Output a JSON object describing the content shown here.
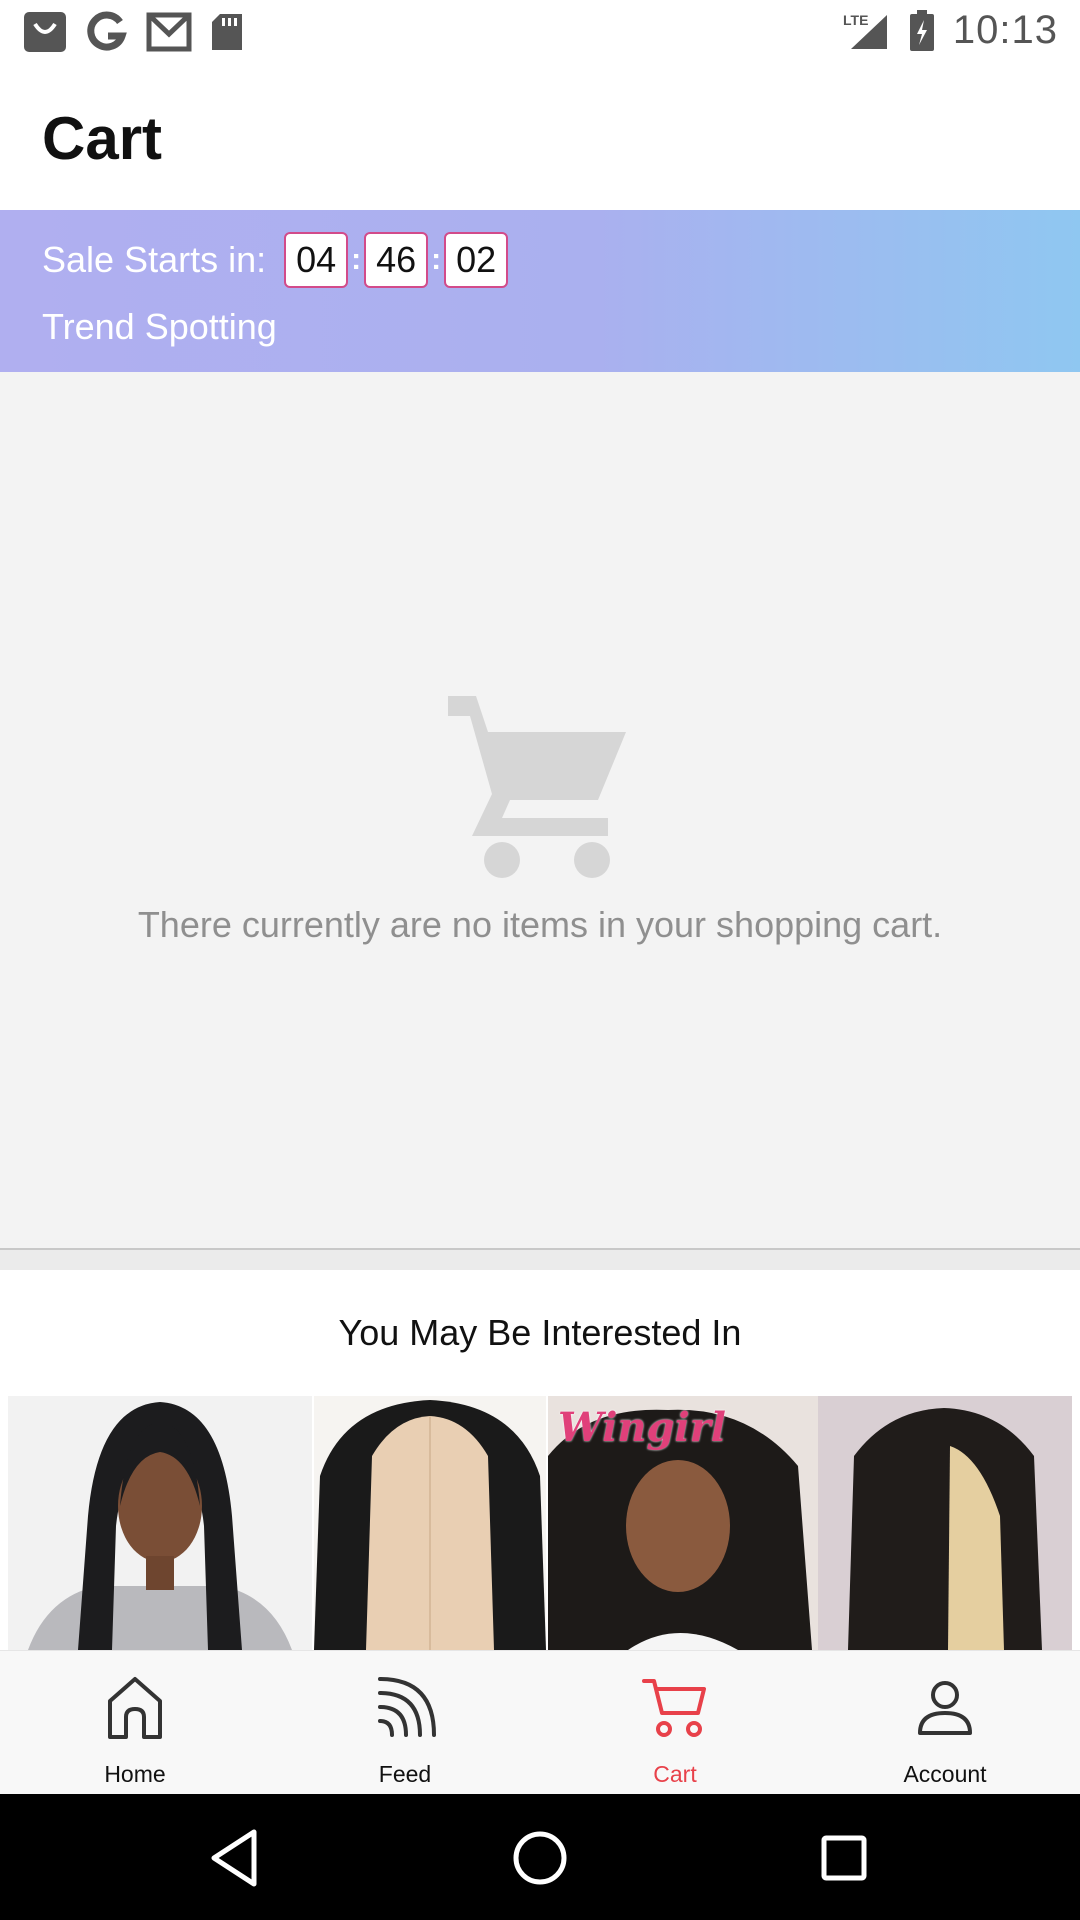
{
  "status_bar": {
    "time": "10:13",
    "network": "LTE",
    "left_icons": [
      "shopping-bag-icon",
      "google-icon",
      "gmail-icon",
      "sd-card-icon"
    ]
  },
  "header": {
    "title": "Cart"
  },
  "banner": {
    "sale_label": "Sale Starts in:",
    "countdown": {
      "hours": "04",
      "minutes": "46",
      "seconds": "02"
    },
    "subtitle": "Trend Spotting",
    "gradient_colors": [
      "#b0aff0",
      "#8fc7f1"
    ]
  },
  "empty_cart": {
    "icon": "shopping-cart-icon",
    "message": "There currently are no items in your shopping cart."
  },
  "recommendations": {
    "title": "You May Be Interested In",
    "products": [
      {
        "image": "straight-hair-model"
      },
      {
        "image": "lace-wig-straight"
      },
      {
        "image": "curly-wig-model",
        "brand_text": "Wingirl"
      }
    ]
  },
  "bottom_nav": {
    "items": [
      {
        "label": "Home",
        "icon": "home-icon",
        "active": false
      },
      {
        "label": "Feed",
        "icon": "feed-icon",
        "active": false
      },
      {
        "label": "Cart",
        "icon": "cart-icon",
        "active": true
      },
      {
        "label": "Account",
        "icon": "account-icon",
        "active": false
      }
    ],
    "active_color": "#e8414a"
  },
  "system_nav": {
    "buttons": [
      "back-icon",
      "home-circle-icon",
      "recents-icon"
    ]
  }
}
